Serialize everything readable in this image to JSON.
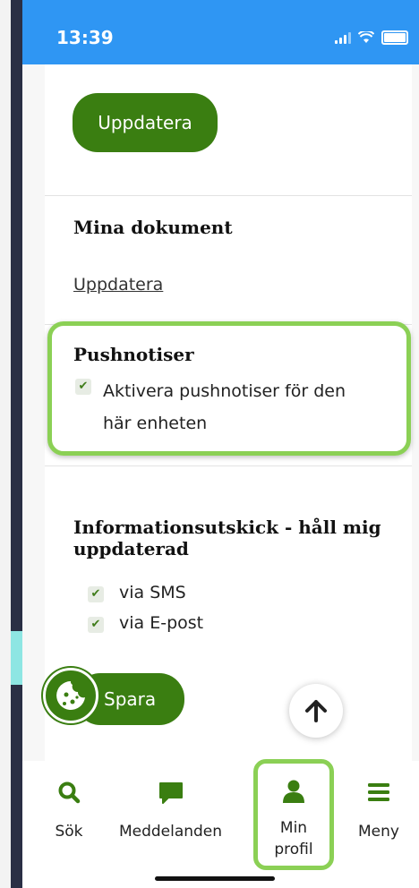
{
  "status": {
    "time": "13:39"
  },
  "top_section": {
    "update_button": "Uppdatera"
  },
  "documents": {
    "title": "Mina dokument",
    "update_link": "Uppdatera"
  },
  "push": {
    "title": "Pushnotiser",
    "checkbox_label_line1": "Aktivera pushnotiser för den",
    "checkbox_label_line2": "här enheten",
    "checked": true
  },
  "info": {
    "title_line1": "Informationsutskick - håll mig",
    "title_line2": "uppdaterad",
    "options": [
      {
        "label": "via SMS",
        "checked": true
      },
      {
        "label": "via E-post",
        "checked": true
      }
    ],
    "save_button": "Spara"
  },
  "tabbar": {
    "items": [
      {
        "label": "Sök",
        "icon": "search-icon"
      },
      {
        "label": "Meddelanden",
        "icon": "chat-icon"
      },
      {
        "label_line1": "Min",
        "label_line2": "profil",
        "icon": "person-icon",
        "active": true
      },
      {
        "label": "Meny",
        "icon": "menu-icon"
      }
    ]
  },
  "colors": {
    "primary_green": "#3a7e11",
    "highlight_green": "#8bd055",
    "status_blue": "#2f96f3"
  }
}
